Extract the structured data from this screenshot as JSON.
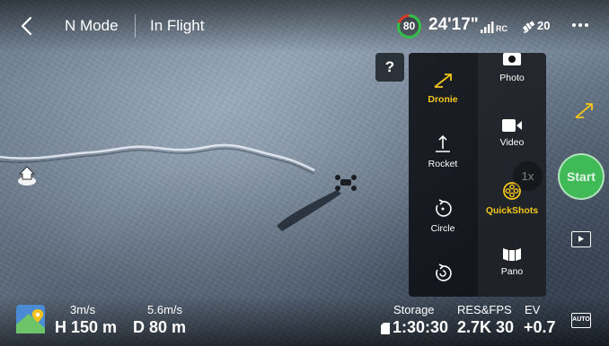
{
  "header": {
    "mode": "N Mode",
    "status": "In Flight",
    "battery_percent": "80",
    "battery_level": 0.8,
    "flight_time": "24'17\"",
    "rc_label": "RC",
    "satellite_count": "20"
  },
  "help_label": "?",
  "quickshots": {
    "left_items": [
      {
        "label": "Dronie",
        "icon": "dronie-icon",
        "active": true
      },
      {
        "label": "Rocket",
        "icon": "rocket-icon"
      },
      {
        "label": "Circle",
        "icon": "circle-icon"
      },
      {
        "label": "",
        "icon": "helix-icon"
      }
    ],
    "right_items": [
      {
        "label": "Photo",
        "icon": "camera-icon"
      },
      {
        "label": "Video",
        "icon": "video-icon"
      },
      {
        "label": "QuickShots",
        "icon": "quickshots-icon",
        "active": true
      },
      {
        "label": "Pano",
        "icon": "pano-icon"
      }
    ]
  },
  "zoom_label": "1x",
  "start_label": "Start",
  "telemetry": {
    "vertical_speed": "3m/s",
    "height": "H 150 m",
    "horizontal_speed": "5.6m/s",
    "distance": "D 80 m"
  },
  "camera": {
    "storage_label": "Storage",
    "storage_value": "1:30:30",
    "resfps_label": "RES&FPS",
    "resfps_value": "2.7K 30",
    "ev_label": "EV",
    "ev_value": "+0.7",
    "auto_label": "AUTO"
  },
  "colors": {
    "accent": "#f3c61b",
    "start_green": "#3fba57",
    "battery_ring": "#2fc24a",
    "battery_ring_bg": "#d93b2b"
  }
}
